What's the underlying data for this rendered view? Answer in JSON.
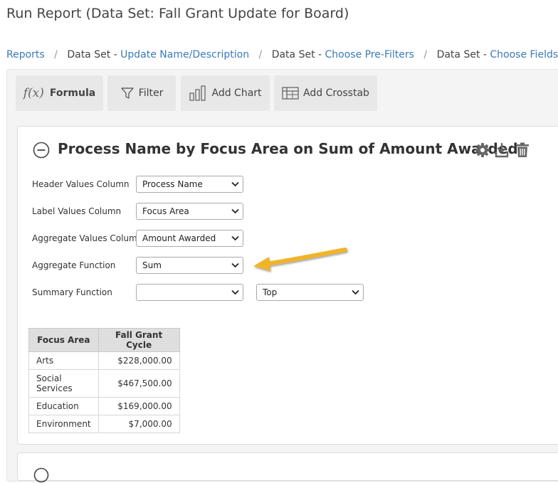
{
  "page": {
    "title": "Run Report (Data Set: Fall Grant Update for Board)"
  },
  "breadcrumb": {
    "reports": "Reports",
    "step1_prefix": "Data Set - ",
    "step1_link": "Update Name/Description",
    "step2_prefix": "Data Set - ",
    "step2_link": "Choose Pre-Filters",
    "step3_prefix": "Data Set - ",
    "step3_link": "Choose Fields"
  },
  "toolbar": {
    "formula_icon": "f(x)",
    "formula_label": "Formula",
    "filter_label": "Filter",
    "add_chart_label": "Add Chart",
    "add_crosstab_label": "Add Crosstab"
  },
  "crosstab": {
    "title": "Process Name by Focus Area on Sum of Amount Awarded",
    "fields": {
      "header_values_label": "Header Values Column",
      "header_values_value": "Process Name",
      "label_values_label": "Label Values Column",
      "label_values_value": "Focus Area",
      "aggregate_values_label": "Aggregate Values Column",
      "aggregate_values_value": "Amount Awarded",
      "aggregate_function_label": "Aggregate Function",
      "aggregate_function_value": "Sum",
      "summary_function_label": "Summary Function",
      "summary_function_value": "",
      "summary_position_value": "Top"
    },
    "table": {
      "col1_header": "Focus Area",
      "col2_header_line1": "Fall Grant",
      "col2_header_line2": "Cycle",
      "rows": [
        {
          "area": "Arts",
          "value": "$228,000.00"
        },
        {
          "area_line1": "Social",
          "area_line2": "Services",
          "value": "$467,500.00"
        },
        {
          "area": "Education",
          "value": "$169,000.00"
        },
        {
          "area": "Environment",
          "value": "$7,000.00"
        }
      ]
    }
  },
  "colors": {
    "link": "#3a7ab7",
    "arrow": "#f0b429",
    "toolbar_bg": "#e8e8e8"
  },
  "icons": {
    "collapse": "minus-circle-icon",
    "settings": "gear-icon",
    "download": "download-icon",
    "delete": "trash-icon",
    "filter": "funnel-icon",
    "chart": "bar-chart-icon",
    "crosstab": "table-icon",
    "annotation": "arrow-icon"
  }
}
